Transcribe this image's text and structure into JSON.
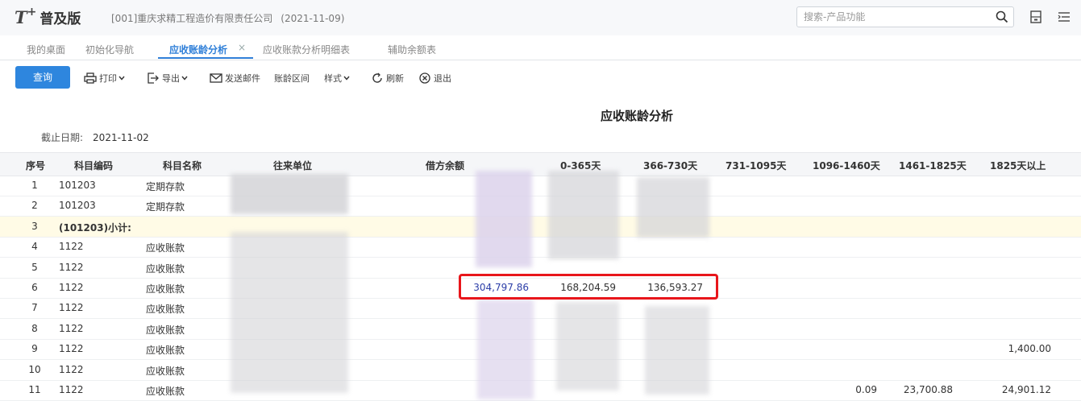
{
  "header": {
    "logo_mark": "T",
    "logo_plus": "+",
    "edition": "普及版",
    "company": "[001]重庆求精工程造价有限责任公司",
    "date": "(2021-11-09)",
    "search_placeholder": "搜索-产品功能",
    "icons": [
      "search-icon",
      "calculator-icon",
      "menu-icon"
    ]
  },
  "tabs": [
    {
      "label": "我的桌面",
      "active": false
    },
    {
      "label": "初始化导航",
      "active": false
    },
    {
      "label": "应收账龄分析",
      "active": true,
      "close": "×"
    },
    {
      "label": "应收账款分析明细表",
      "active": false
    },
    {
      "label": "辅助余额表",
      "active": false
    }
  ],
  "toolbar": {
    "query": "查询",
    "print": "打印",
    "export": "导出",
    "send_mail": "发送邮件",
    "aging_range": "账龄区间",
    "style": "样式",
    "refresh": "刷新",
    "exit": "退出"
  },
  "report": {
    "title": "应收账龄分析",
    "cutoff_label": "截止日期:",
    "cutoff_value": "2021-11-02"
  },
  "table": {
    "columns": [
      "序号",
      "科目编码",
      "科目名称",
      "往来单位",
      "借方余额",
      "0-365天",
      "366-730天",
      "731-1095天",
      "1096-1460天",
      "1461-1825天",
      "1825天以上"
    ],
    "rows": [
      {
        "no": "1",
        "code": "101203",
        "name": "定期存款",
        "debit": "",
        "d365": "",
        "d730": "",
        "d1095": "",
        "d1460": "",
        "d1825": "",
        "d1825p": "",
        "subtotal": false
      },
      {
        "no": "2",
        "code": "101203",
        "name": "定期存款",
        "debit": "",
        "d365": "",
        "d730": "",
        "d1095": "",
        "d1460": "",
        "d1825": "",
        "d1825p": "",
        "subtotal": false
      },
      {
        "no": "3",
        "code": "(101203)小计:",
        "name": "",
        "debit": "",
        "d365": "",
        "d730": "",
        "d1095": "",
        "d1460": "",
        "d1825": "",
        "d1825p": "",
        "subtotal": true
      },
      {
        "no": "4",
        "code": "1122",
        "name": "应收账款",
        "debit": "",
        "d365": "",
        "d730": "",
        "d1095": "",
        "d1460": "",
        "d1825": "",
        "d1825p": "",
        "subtotal": false
      },
      {
        "no": "5",
        "code": "1122",
        "name": "应收账款",
        "debit": "",
        "d365": "",
        "d730": "",
        "d1095": "",
        "d1460": "",
        "d1825": "",
        "d1825p": "",
        "subtotal": false
      },
      {
        "no": "6",
        "code": "1122",
        "name": "应收账款",
        "debit": "304,797.86",
        "d365": "168,204.59",
        "d730": "136,593.27",
        "d1095": "",
        "d1460": "",
        "d1825": "",
        "d1825p": "",
        "subtotal": false
      },
      {
        "no": "7",
        "code": "1122",
        "name": "应收账款",
        "debit": "",
        "d365": "",
        "d730": "",
        "d1095": "",
        "d1460": "",
        "d1825": "",
        "d1825p": "",
        "subtotal": false
      },
      {
        "no": "8",
        "code": "1122",
        "name": "应收账款",
        "debit": "",
        "d365": "",
        "d730": "",
        "d1095": "",
        "d1460": "",
        "d1825": "",
        "d1825p": "",
        "subtotal": false
      },
      {
        "no": "9",
        "code": "1122",
        "name": "应收账款",
        "debit": "",
        "d365": "",
        "d730": "",
        "d1095": "",
        "d1460": "",
        "d1825": "",
        "d1825p": "1,400.00",
        "subtotal": false
      },
      {
        "no": "10",
        "code": "1122",
        "name": "应收账款",
        "debit": "",
        "d365": "",
        "d730": "",
        "d1095": "",
        "d1460": "",
        "d1825": "",
        "d1825p": "",
        "subtotal": false
      },
      {
        "no": "11",
        "code": "1122",
        "name": "应收账款",
        "debit": "",
        "d365": "",
        "d730": "",
        "d1095": "",
        "d1460": "0.09",
        "d1825": "23,700.88",
        "d1825p": "24,901.12",
        "subtotal": false
      }
    ]
  },
  "colors": {
    "accent": "#2e86de",
    "highlight": "#e8161b",
    "subtotal_bg": "#fffbe6",
    "debit_text": "#2c3ea8"
  }
}
